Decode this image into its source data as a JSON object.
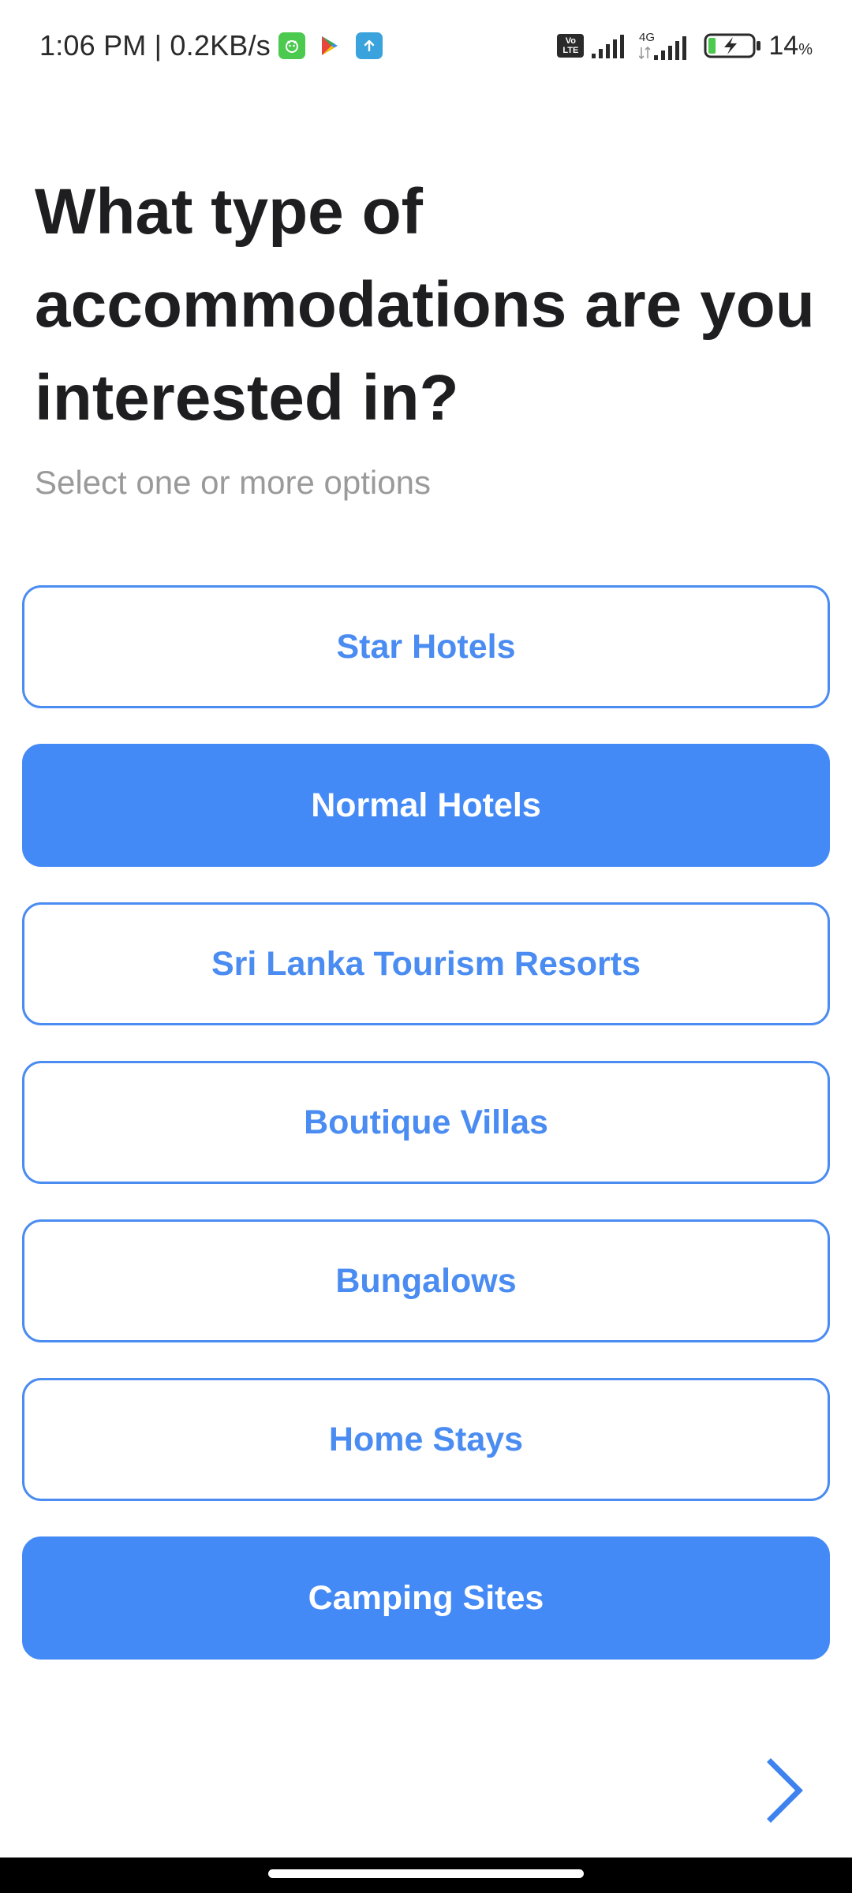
{
  "status_bar": {
    "time_speed": "1:06 PM | 0.2KB/s",
    "volte_top": "Vo",
    "volte_bottom": "LTE",
    "network_type": "4G",
    "battery_percent": "14",
    "battery_percent_sign": "%",
    "battery_level": 0.14,
    "icons": [
      "app-notification-icon",
      "play-store-icon",
      "upload-icon",
      "volte-icon",
      "signal-icon",
      "signal-4g-icon",
      "battery-charging-icon"
    ]
  },
  "header": {
    "title": "What type of accommodations are you interested in?",
    "subtitle": "Select one or more options"
  },
  "options": [
    {
      "label": "Star Hotels",
      "selected": false
    },
    {
      "label": "Normal Hotels",
      "selected": true
    },
    {
      "label": "Sri Lanka Tourism Resorts",
      "selected": false
    },
    {
      "label": "Boutique Villas",
      "selected": false
    },
    {
      "label": "Bungalows",
      "selected": false
    },
    {
      "label": "Home Stays",
      "selected": false
    },
    {
      "label": "Camping Sites",
      "selected": true
    }
  ],
  "navigation": {
    "next_icon": "chevron-right-icon"
  },
  "colors": {
    "accent": "#448af6",
    "outline": "#4a8cf1",
    "title": "#1e1e21",
    "subtitle": "#9a9a9a"
  }
}
